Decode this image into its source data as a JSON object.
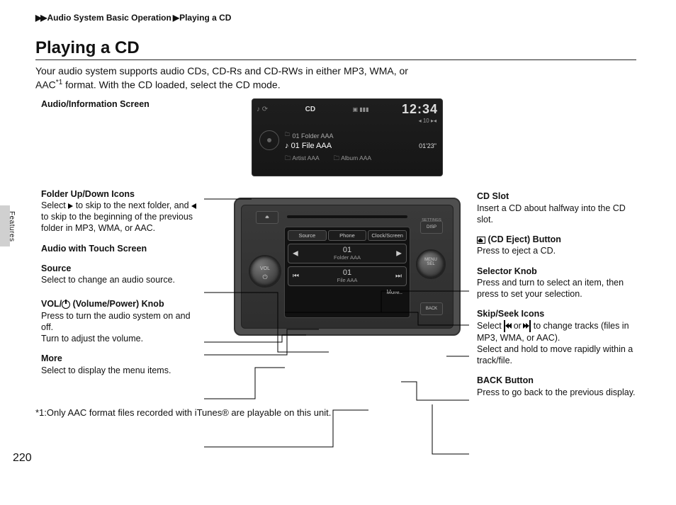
{
  "breadcrumb": {
    "a": "Audio System Basic Operation",
    "b": "Playing a CD"
  },
  "title": "Playing a CD",
  "intro": {
    "line1": "Your audio system supports audio CDs, CD-Rs and CD-RWs in either MP3, WMA, or",
    "line2a": "AAC",
    "line2sup": "*1",
    "line2b": " format. With the CD loaded, select the CD mode."
  },
  "left": {
    "c1": {
      "label": "Audio/Information Screen"
    },
    "c2": {
      "label": "Folder Up/Down Icons",
      "desc1": "Select ",
      "desc2": " to skip to the next folder, and ",
      "desc3": " to skip to the beginning of the previous folder in MP3, WMA, or AAC."
    },
    "c3": {
      "label": "Audio with Touch Screen"
    },
    "c4": {
      "label": "Source",
      "desc": "Select to change an audio source."
    },
    "c5": {
      "label_pre": "VOL/",
      "label_post": " (Volume/Power) Knob",
      "desc1": "Press to turn the audio system on and off.",
      "desc2": "Turn to adjust the volume."
    },
    "c6": {
      "label": "More",
      "desc": "Select to display the menu items."
    }
  },
  "right": {
    "c1": {
      "label": "CD Slot",
      "desc": "Insert a CD about halfway into the CD slot."
    },
    "c2": {
      "label": " (CD Eject) Button",
      "desc": "Press to eject a CD."
    },
    "c3": {
      "label": "Selector Knob",
      "desc": "Press and turn to select an item, then press to set your selection."
    },
    "c4": {
      "label": "Skip/Seek Icons",
      "desc1": "Select ",
      "desc_or": " or ",
      "desc2": " to change tracks (files in MP3, WMA, or AAC).",
      "desc3": "Select and hold to move rapidly within a track/file."
    },
    "c5": {
      "label": "BACK Button",
      "desc": "Press to go back to the previous display."
    }
  },
  "lcd": {
    "mode": "CD",
    "clock": "12:34",
    "track_indicator": "◂ 10 ▸◂",
    "folder": "01  Folder AAA",
    "file": "01 File AAA",
    "time": "01'23\"",
    "artist": "Artist AAA",
    "album": "Album AAA"
  },
  "unit": {
    "eject": "⏏",
    "disp_top": "SETTINGS",
    "disp": "DISP",
    "back": "BACK",
    "vol_label": "VOL",
    "sel_label": "MENU\nSEL",
    "tabs": {
      "a": "Source",
      "b": "Phone",
      "c": "Clock/Screen"
    },
    "folder_num": "01",
    "folder_name": "Folder AAA",
    "file_num": "01",
    "file_name": "File AAA",
    "more": "More.."
  },
  "footnote": "*1:Only AAC format files recorded with iTunes® are playable on this unit.",
  "page": "220",
  "sidetab": "Features"
}
